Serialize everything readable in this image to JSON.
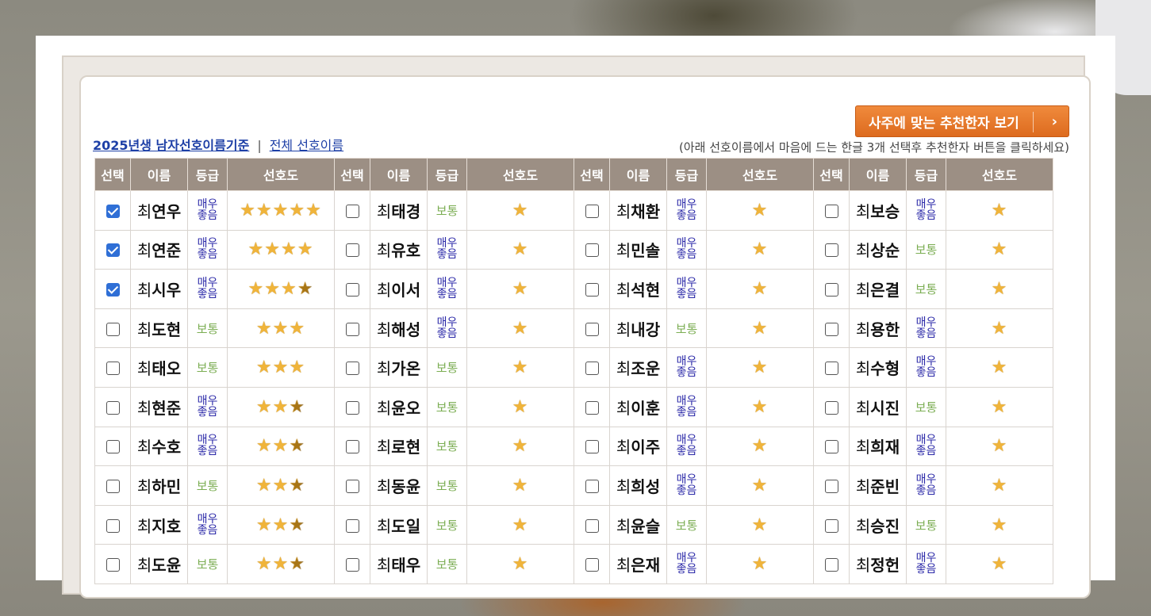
{
  "button": {
    "label": "사주에 맞는 추천한자 보기",
    "chevron": "›"
  },
  "links": {
    "primary": "2025년생 남자선호이름기준",
    "separator": "|",
    "secondary": "전체 선호이름"
  },
  "hint": "(아래 선호이름에서 마음에 드는 한글 3개 선택후 추천한자 버튼을 클릭하세요)",
  "headers": [
    "선택",
    "이름",
    "등급",
    "선호도"
  ],
  "surname": "최",
  "grades": {
    "great": "매우 좋음",
    "normal": "보통"
  },
  "colors": {
    "header_bg": "#9c8f84",
    "button": "#e9752a",
    "great": "#2b29a8",
    "normal": "#7cae54",
    "star": "#f0b43a"
  },
  "columns": [
    [
      {
        "name": "연우",
        "grade": "great",
        "stars": 5,
        "checked": true
      },
      {
        "name": "연준",
        "grade": "great",
        "stars": 4,
        "checked": true
      },
      {
        "name": "시우",
        "grade": "great",
        "stars": 3.5,
        "checked": true
      },
      {
        "name": "도현",
        "grade": "normal",
        "stars": 3,
        "checked": false
      },
      {
        "name": "태오",
        "grade": "normal",
        "stars": 3,
        "checked": false
      },
      {
        "name": "현준",
        "grade": "great",
        "stars": 2.5,
        "checked": false
      },
      {
        "name": "수호",
        "grade": "great",
        "stars": 2.5,
        "checked": false
      },
      {
        "name": "하민",
        "grade": "normal",
        "stars": 2.5,
        "checked": false
      },
      {
        "name": "지호",
        "grade": "great",
        "stars": 2.5,
        "checked": false
      },
      {
        "name": "도윤",
        "grade": "normal",
        "stars": 2.5,
        "checked": false
      }
    ],
    [
      {
        "name": "태경",
        "grade": "normal",
        "stars": 1,
        "checked": false
      },
      {
        "name": "유호",
        "grade": "great",
        "stars": 1,
        "checked": false
      },
      {
        "name": "이서",
        "grade": "great",
        "stars": 1,
        "checked": false
      },
      {
        "name": "해성",
        "grade": "great",
        "stars": 1,
        "checked": false
      },
      {
        "name": "가온",
        "grade": "normal",
        "stars": 1,
        "checked": false
      },
      {
        "name": "윤오",
        "grade": "normal",
        "stars": 1,
        "checked": false
      },
      {
        "name": "로현",
        "grade": "normal",
        "stars": 1,
        "checked": false
      },
      {
        "name": "동윤",
        "grade": "normal",
        "stars": 1,
        "checked": false
      },
      {
        "name": "도일",
        "grade": "normal",
        "stars": 1,
        "checked": false
      },
      {
        "name": "태우",
        "grade": "normal",
        "stars": 1,
        "checked": false
      }
    ],
    [
      {
        "name": "채환",
        "grade": "great",
        "stars": 1,
        "checked": false
      },
      {
        "name": "민솔",
        "grade": "great",
        "stars": 1,
        "checked": false
      },
      {
        "name": "석현",
        "grade": "great",
        "stars": 1,
        "checked": false
      },
      {
        "name": "내강",
        "grade": "normal",
        "stars": 1,
        "checked": false
      },
      {
        "name": "조운",
        "grade": "great",
        "stars": 1,
        "checked": false
      },
      {
        "name": "이훈",
        "grade": "great",
        "stars": 1,
        "checked": false
      },
      {
        "name": "이주",
        "grade": "great",
        "stars": 1,
        "checked": false
      },
      {
        "name": "희성",
        "grade": "great",
        "stars": 1,
        "checked": false
      },
      {
        "name": "윤슬",
        "grade": "normal",
        "stars": 1,
        "checked": false
      },
      {
        "name": "은재",
        "grade": "great",
        "stars": 1,
        "checked": false
      }
    ],
    [
      {
        "name": "보승",
        "grade": "great",
        "stars": 1,
        "checked": false
      },
      {
        "name": "상순",
        "grade": "normal",
        "stars": 1,
        "checked": false
      },
      {
        "name": "은결",
        "grade": "normal",
        "stars": 1,
        "checked": false
      },
      {
        "name": "용한",
        "grade": "great",
        "stars": 1,
        "checked": false
      },
      {
        "name": "수형",
        "grade": "great",
        "stars": 1,
        "checked": false
      },
      {
        "name": "시진",
        "grade": "normal",
        "stars": 1,
        "checked": false
      },
      {
        "name": "희재",
        "grade": "great",
        "stars": 1,
        "checked": false
      },
      {
        "name": "준빈",
        "grade": "great",
        "stars": 1,
        "checked": false
      },
      {
        "name": "승진",
        "grade": "normal",
        "stars": 1,
        "checked": false
      },
      {
        "name": "정헌",
        "grade": "great",
        "stars": 1,
        "checked": false
      }
    ]
  ]
}
